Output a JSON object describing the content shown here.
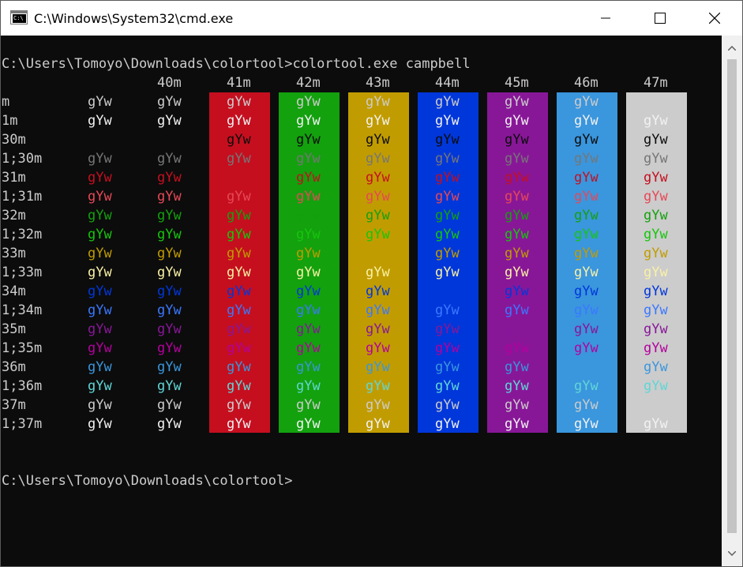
{
  "window": {
    "title": "C:\\Windows\\System32\\cmd.exe",
    "icon_label": "C:\\"
  },
  "console": {
    "command_line": "C:\\Users\\Tomoyo\\Downloads\\colortool>colortool.exe campbell",
    "prompt_line": "C:\\Users\\Tomoyo\\Downloads\\colortool>",
    "sample_text": "gYw",
    "column_headers": [
      "40m",
      "41m",
      "42m",
      "43m",
      "44m",
      "45m",
      "46m",
      "47m"
    ],
    "row_labels": [
      "m",
      "1m",
      "30m",
      "1;30m",
      "31m",
      "1;31m",
      "32m",
      "1;32m",
      "33m",
      "1;33m",
      "34m",
      "1;34m",
      "35m",
      "1;35m",
      "36m",
      "1;36m",
      "37m",
      "1;37m"
    ],
    "background_colors": [
      "#0c0c0c",
      "#c50f1f",
      "#13a10e",
      "#c19c00",
      "#0037da",
      "#881798",
      "#3a96dd",
      "#cccccc"
    ],
    "foreground_colors": {
      "default": "#cccccc",
      "30m": "#0c0c0c",
      "1;30m": "#767676",
      "31m": "#c50f1f",
      "1;31m": "#e74856",
      "32m": "#13a10e",
      "1;32m": "#16c60c",
      "33m": "#c19c00",
      "1;33m": "#f9f1a5",
      "34m": "#0037da",
      "1;34m": "#3b78ff",
      "35m": "#881798",
      "1;35m": "#b4009e",
      "36m": "#3a96dd",
      "1;36m": "#61d6d6",
      "37m": "#cccccc",
      "1;37m": "#f2f2f2"
    }
  }
}
